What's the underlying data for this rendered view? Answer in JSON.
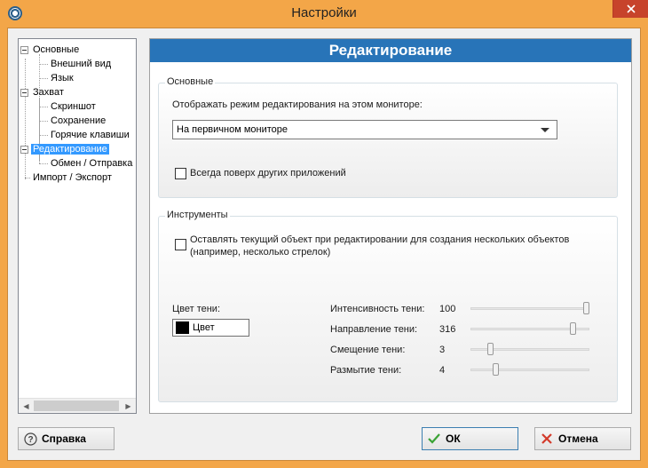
{
  "window": {
    "title": "Настройки"
  },
  "tree": {
    "items": [
      {
        "label": "Основные"
      },
      {
        "label": "Внешний вид"
      },
      {
        "label": "Язык"
      },
      {
        "label": "Захват"
      },
      {
        "label": "Скриншот"
      },
      {
        "label": "Сохранение"
      },
      {
        "label": "Горячие клавиши"
      },
      {
        "label": "Редактирование"
      },
      {
        "label": "Обмен / Отправка"
      },
      {
        "label": "Импорт / Экспорт"
      }
    ]
  },
  "panel": {
    "title": "Редактирование"
  },
  "general": {
    "title": "Основные",
    "monitor_label": "Отображать режим редактирования на этом мониторе:",
    "monitor_value": "На первичном мониторе",
    "always_on_top_label": "Всегда поверх других приложений",
    "always_on_top_checked": false
  },
  "tools": {
    "title": "Инструменты",
    "keep_object_label_line1": "Оставлять текущий объект при редактировании для создания нескольких объектов",
    "keep_object_label_line2": "(например, несколько стрелок)",
    "keep_object_checked": false,
    "shadow_color_label": "Цвет тени:",
    "color_button_label": "Цвет",
    "shadow_color": "#000000",
    "sliders": [
      {
        "label": "Интенсивность тени:",
        "value": "100",
        "fraction": 1.0
      },
      {
        "label": "Направление тени:",
        "value": "316",
        "fraction": 0.88
      },
      {
        "label": "Смещение тени:",
        "value": "3",
        "fraction": 0.15
      },
      {
        "label": "Размытие тени:",
        "value": "4",
        "fraction": 0.2
      }
    ]
  },
  "buttons": {
    "help": "Справка",
    "ok": "ОК",
    "cancel": "Отмена"
  },
  "colors": {
    "titlebar": "#f3a648",
    "panel_header": "#2874b8",
    "selection": "#3399ff",
    "close": "#c7432b"
  }
}
